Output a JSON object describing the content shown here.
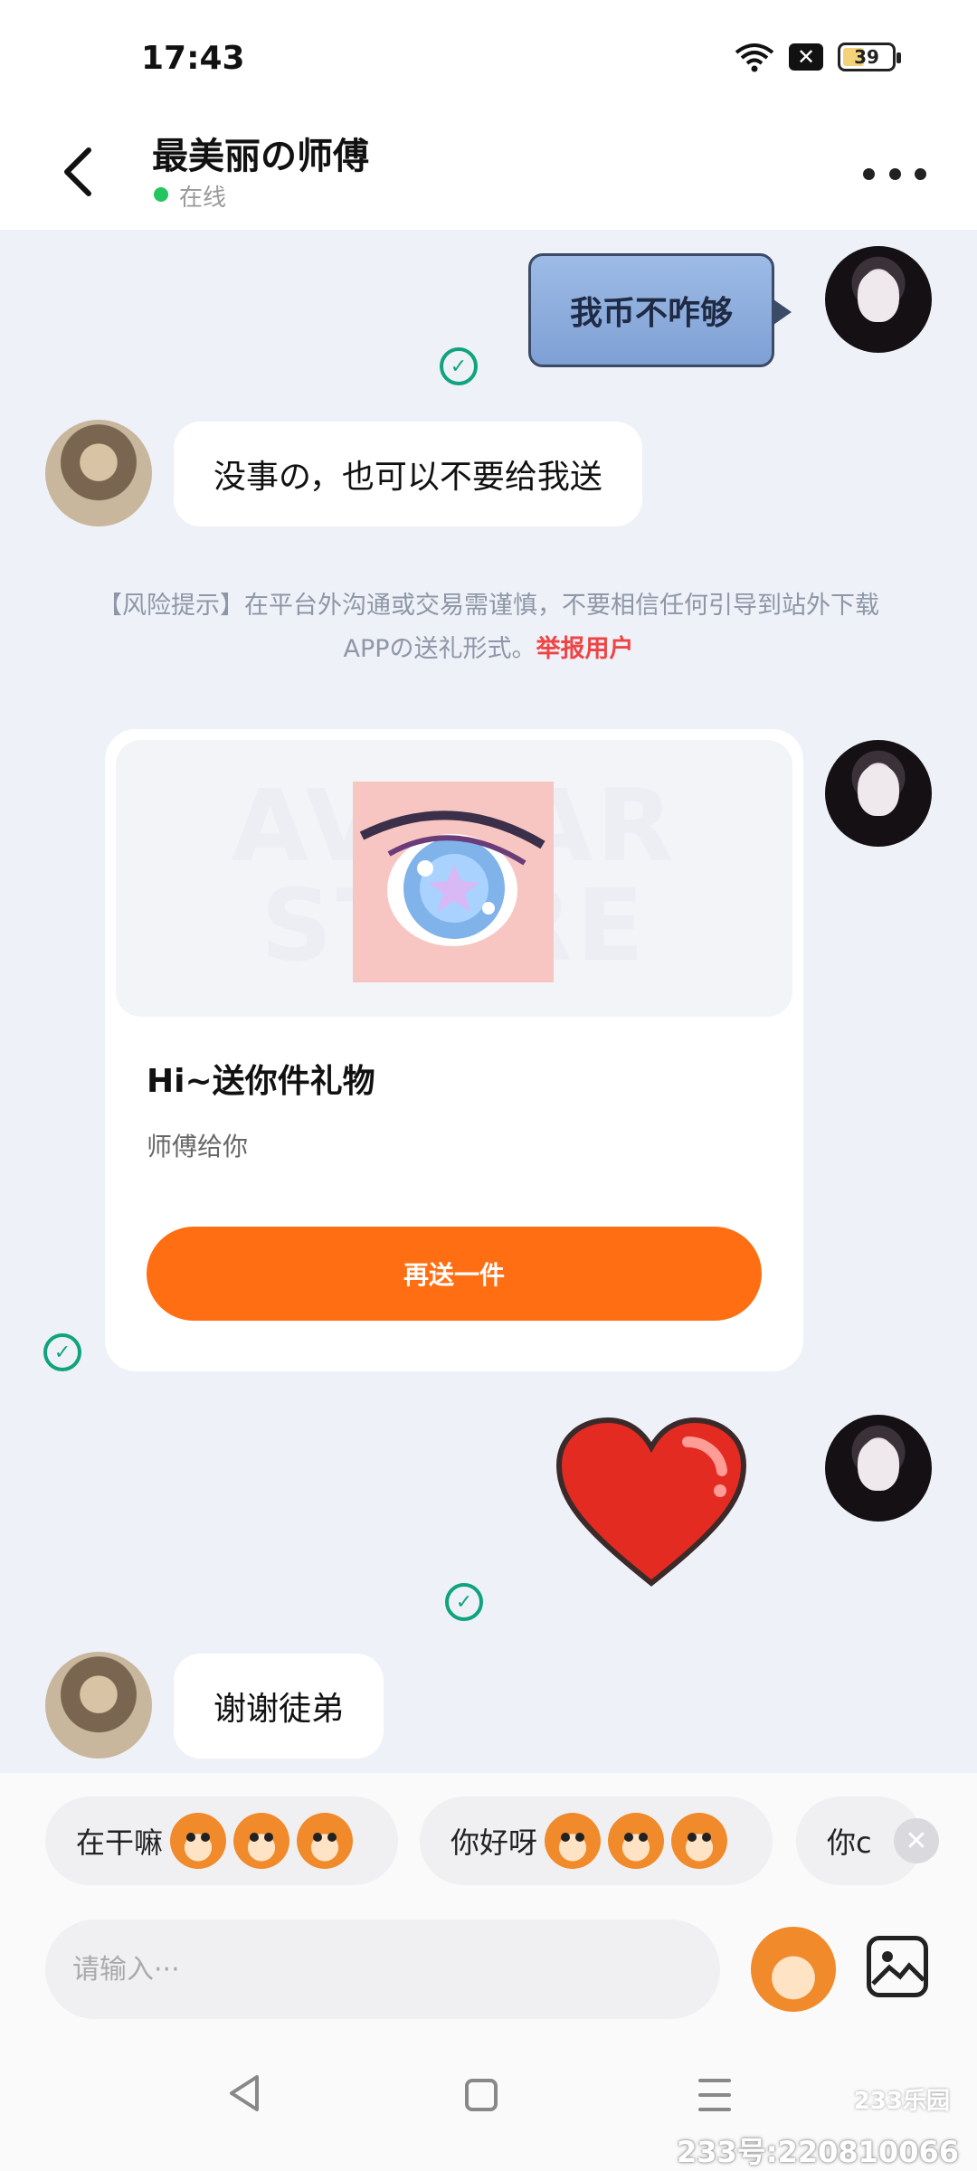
{
  "status": {
    "time": "17:43",
    "battery": "39",
    "close_glyph": "✕"
  },
  "header": {
    "title": "最美丽の师傅",
    "online": "在线",
    "back_icon": "chevron-left-icon",
    "more_icon": "more-horizontal-icon"
  },
  "messages": {
    "m1": "我币不咋够",
    "m2": "没事の，也可以不要给我送",
    "m3": "谢谢徒弟"
  },
  "risk": {
    "text": "【风险提示】在平台外沟通或交易需谨慎，不要相信任何引导到站外下载APPの送礼形式。",
    "link": "举报用户"
  },
  "gift": {
    "watermark_top": "AVATAR",
    "watermark_bottom": "STORE",
    "title": "Hi~送你件礼物",
    "subtitle": "师傅给你",
    "button": "再送一件"
  },
  "quick_replies": [
    {
      "label": "在干嘛"
    },
    {
      "label": "你好呀"
    },
    {
      "label": "你c"
    }
  ],
  "quick_close": "✕",
  "input": {
    "placeholder": "请输入···"
  },
  "watermark": {
    "logo": "233乐园",
    "id": "233号:220810066"
  },
  "colors": {
    "accent": "#ff6e12",
    "online": "#22c55e",
    "check": "#10a37f",
    "report_link": "#ef4444"
  }
}
